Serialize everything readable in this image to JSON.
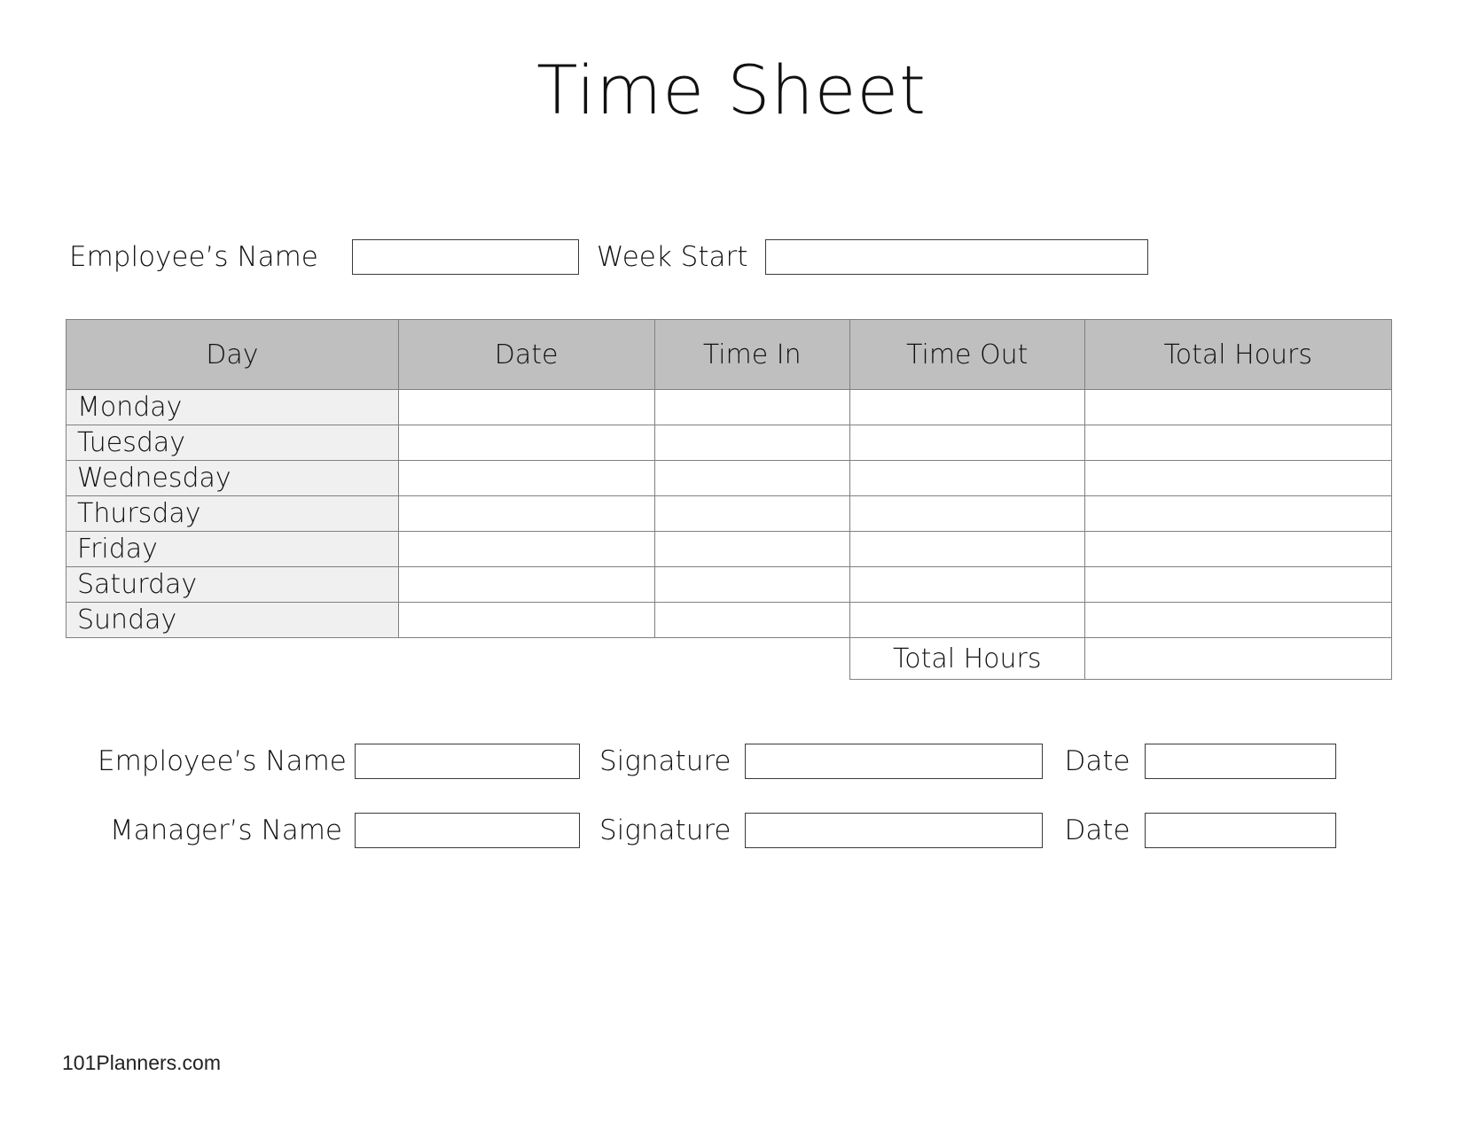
{
  "document": {
    "title": "Time Sheet"
  },
  "top_info": {
    "employee_name_label": "Employee’s Name",
    "employee_name_value": "",
    "week_start_label": "Week Start",
    "week_start_value": ""
  },
  "table": {
    "headers": [
      "Day",
      "Date",
      "Time In",
      "Time Out",
      "Total Hours"
    ],
    "rows": [
      {
        "day": "Monday",
        "date": "",
        "time_in": "",
        "time_out": "",
        "total_hours": ""
      },
      {
        "day": "Tuesday",
        "date": "",
        "time_in": "",
        "time_out": "",
        "total_hours": ""
      },
      {
        "day": "Wednesday",
        "date": "",
        "time_in": "",
        "time_out": "",
        "total_hours": ""
      },
      {
        "day": "Thursday",
        "date": "",
        "time_in": "",
        "time_out": "",
        "total_hours": ""
      },
      {
        "day": "Friday",
        "date": "",
        "time_in": "",
        "time_out": "",
        "total_hours": ""
      },
      {
        "day": "Saturday",
        "date": "",
        "time_in": "",
        "time_out": "",
        "total_hours": ""
      },
      {
        "day": "Sunday",
        "date": "",
        "time_in": "",
        "time_out": "",
        "total_hours": ""
      }
    ],
    "total_row": {
      "label": "Total Hours",
      "value": ""
    }
  },
  "signatures": {
    "employee": {
      "name_label": "Employee’s Name",
      "name_value": "",
      "signature_label": "Signature",
      "signature_value": "",
      "date_label": "Date",
      "date_value": ""
    },
    "manager": {
      "name_label": "Manager’s Name",
      "name_value": "",
      "signature_label": "Signature",
      "signature_value": "",
      "date_label": "Date",
      "date_value": ""
    }
  },
  "footer": {
    "watermark": "101Planners.com"
  },
  "colors": {
    "header_fill": "#bfbfbf",
    "day_cell_fill": "#f0f0f0",
    "border": "#808080",
    "text": "#111111",
    "page_background": "#ffffff"
  }
}
